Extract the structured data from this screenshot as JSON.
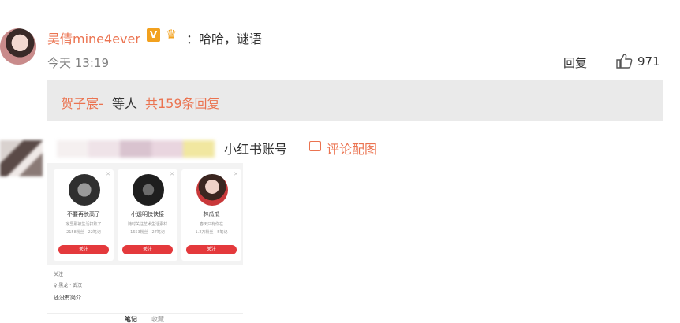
{
  "comment1": {
    "username": "吴倩mine4ever",
    "badge": "V",
    "crown": "♛",
    "text": "：哈哈，谜语",
    "time": "今天 13:19",
    "reply_label": "回复",
    "likes": "971"
  },
  "subreply": {
    "name": "贺子宸-",
    "text": "等人",
    "link": "共159条回复"
  },
  "comment2": {
    "username": "小红书账号",
    "pic_label": "评论配图"
  },
  "screenshot": {
    "cards": [
      {
        "name": "不要再长高了",
        "desc": "家里那被生活打败了",
        "stat": "2158粉丝 · 22笔记",
        "button": "关注"
      },
      {
        "name": "小透明快快接",
        "desc": "随时关注艺术生活素材",
        "stat": "1653粉丝 · 27笔记",
        "button": "关注"
      },
      {
        "name": "林瓜瓜",
        "desc": "春天只有你在",
        "stat": "1.2万粉丝 · 5笔记",
        "button": "关注"
      }
    ],
    "profile": {
      "l1": "关注",
      "l2": "♀ 黑龙 · 武汉",
      "l3": "还没有简介",
      "tab_notes": "笔记",
      "tab_collect": "收藏"
    }
  },
  "colors": {
    "accent": "#eb7350",
    "follow_red": "#e4393c",
    "badge": "#f2a11e"
  }
}
